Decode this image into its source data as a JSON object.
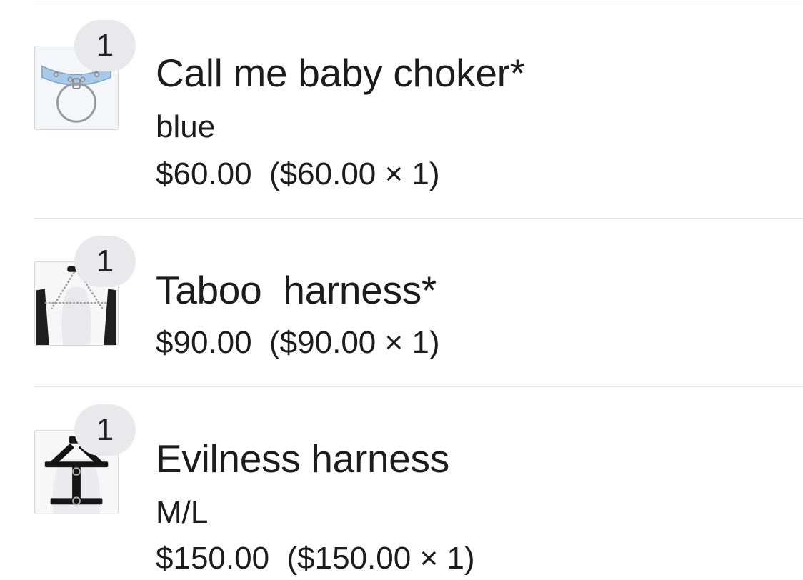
{
  "cart": {
    "items": [
      {
        "quantity": "1",
        "title": "Call me baby choker*",
        "variant": "blue",
        "line_price": "$60.00",
        "unit_breakdown": "($60.00 × 1)",
        "image_icon": "choker-product-image"
      },
      {
        "quantity": "1",
        "title": "Taboo  harness*",
        "line_price": "$90.00",
        "unit_breakdown": "($90.00 × 1)",
        "image_icon": "harness-product-image"
      },
      {
        "quantity": "1",
        "title": "Evilness harness",
        "variant": "M/L",
        "line_price": "$150.00",
        "unit_breakdown": "($150.00 × 1)",
        "image_icon": "harness-product-image"
      }
    ]
  },
  "colors": {
    "badge_bg": "#e9e9eb",
    "divider": "#e3e3e6",
    "text": "#1c1c1e",
    "choker_blue": "#a9c9ea"
  }
}
